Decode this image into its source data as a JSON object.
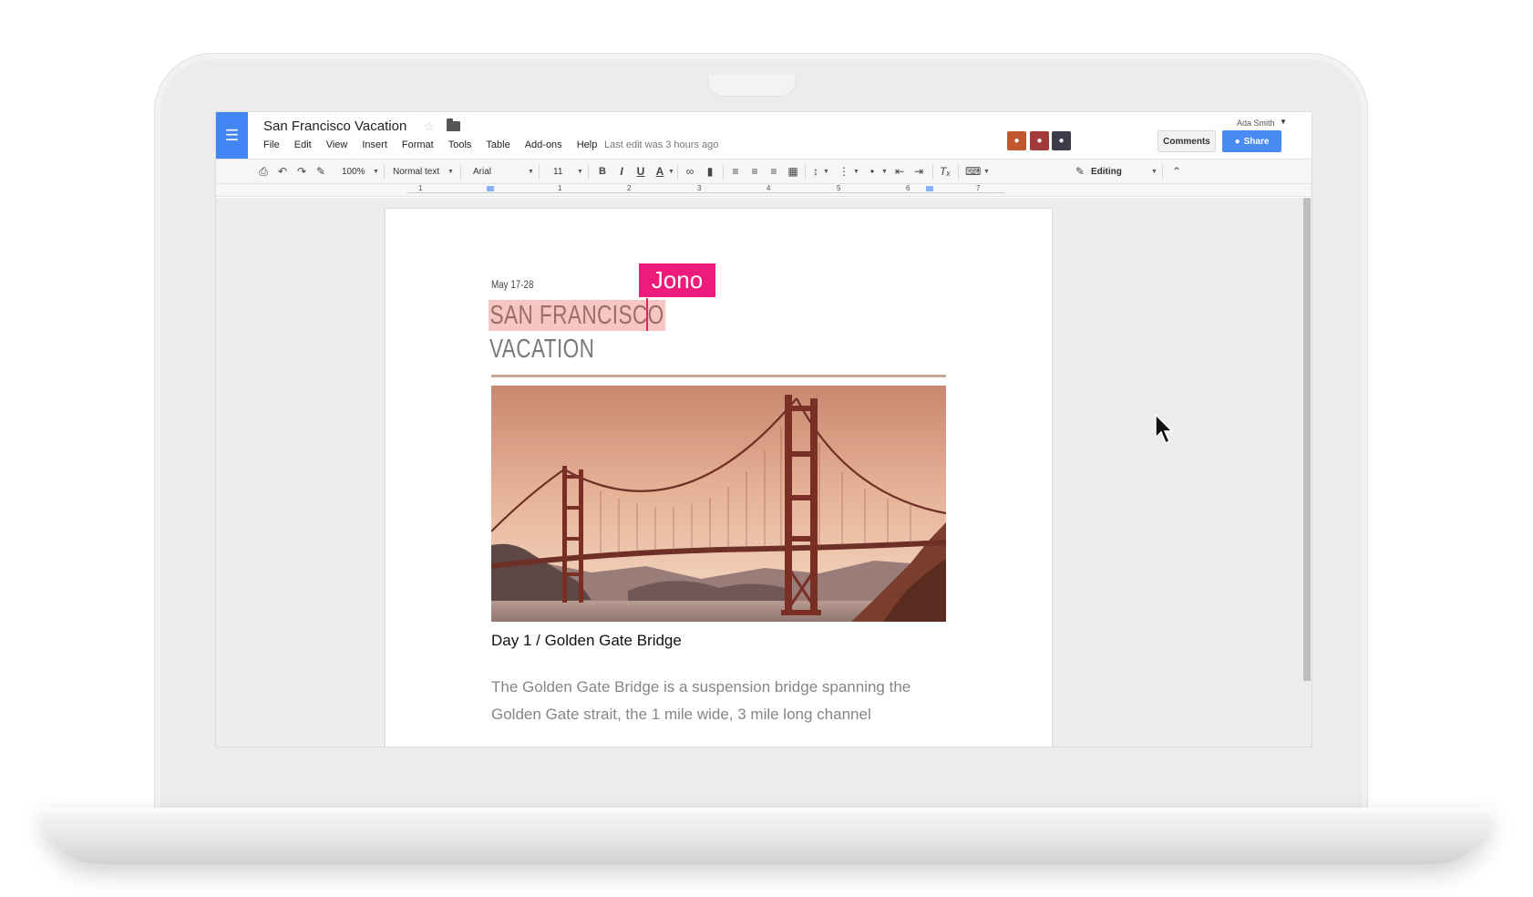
{
  "document": {
    "title": "San Francisco Vacation",
    "last_edit": "Last edit was 3 hours ago",
    "menu": [
      "File",
      "Edit",
      "View",
      "Insert",
      "Format",
      "Tools",
      "Table",
      "Add-ons",
      "Help"
    ]
  },
  "user": {
    "name": "Ada Smith",
    "avatars": [
      {
        "icon": "collaborator-avatar",
        "color": "#c0572e"
      },
      {
        "icon": "collaborator-avatar",
        "color": "#a33a3a"
      },
      {
        "icon": "collaborator-avatar",
        "color": "#3b3b4a"
      }
    ]
  },
  "actions": {
    "comments_label": "Comments",
    "share_label": "Share"
  },
  "toolbar": {
    "zoom": "100%",
    "style": "Normal text",
    "font": "Arial",
    "size": "11",
    "bold": "B",
    "italic": "I",
    "underline": "U",
    "text_color": "A",
    "mode": "Editing"
  },
  "ruler": {
    "numbers": [
      "1",
      "1",
      "2",
      "3",
      "4",
      "5",
      "6",
      "7"
    ]
  },
  "page": {
    "date": "May 17-28",
    "title_line1": "SAN FRANCISCO",
    "title_line2": "VACATION",
    "collaborator": "Jono",
    "day_heading": "Day 1 / Golden Gate Bridge",
    "body": "The Golden Gate Bridge is a suspension bridge spanning the Golden Gate strait, the 1 mile wide, 3 mile long channel"
  },
  "colors": {
    "docs_blue": "#4285f4",
    "share_blue": "#4a8af4",
    "collab_pink": "#ed1b7c",
    "title_highlight": "#f4c7c3"
  }
}
